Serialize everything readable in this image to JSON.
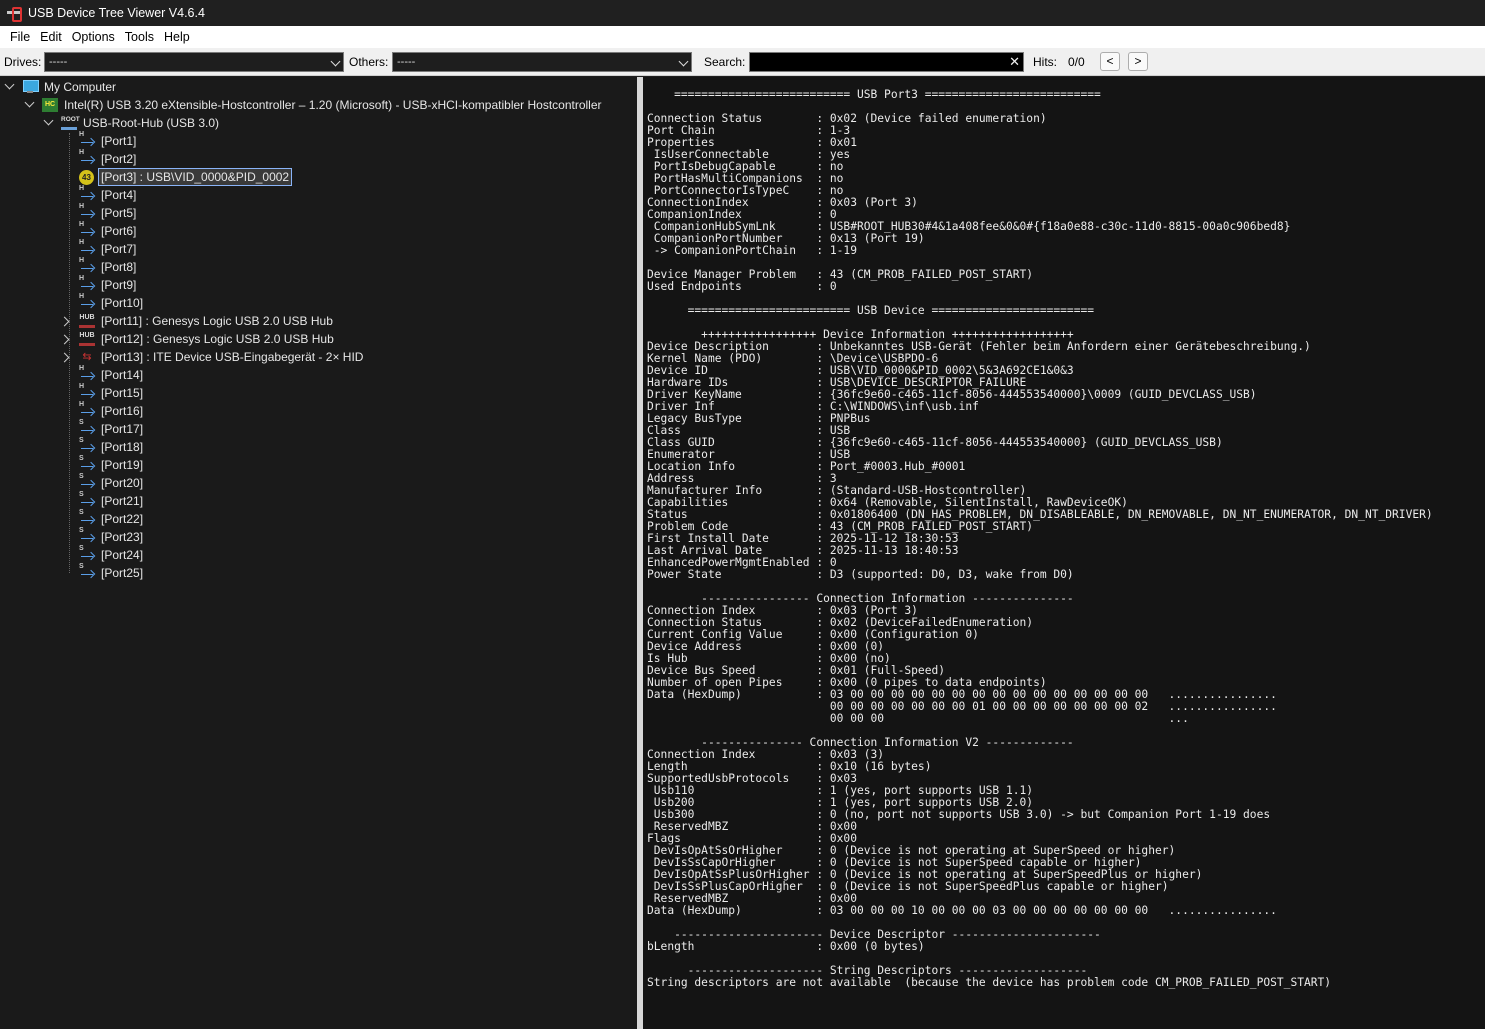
{
  "window": {
    "title": "USB Device Tree Viewer V4.6.4"
  },
  "menu": [
    "File",
    "Edit",
    "Options",
    "Tools",
    "Help"
  ],
  "toolbar": {
    "drives_label": "Drives:",
    "drives_value": "-----",
    "others_label": "Others:",
    "others_value": "-----",
    "search_label": "Search:",
    "search_value": "",
    "clear_glyph": "✕",
    "hits_label": "Hits:",
    "hits_value": "0/0",
    "prev": "<",
    "next": ">"
  },
  "tree": {
    "root": "My Computer",
    "controller": "Intel(R) USB 3.20 eXtensible-Hostcontroller – 1.20 (Microsoft) - USB-xHCI-kompatibler Hostcontroller",
    "hub": "USB-Root-Hub (USB 3.0)",
    "ports": [
      "[Port1]",
      "[Port2]",
      "[Port3] : USB\\VID_0000&PID_0002",
      "[Port4]",
      "[Port5]",
      "[Port6]",
      "[Port7]",
      "[Port8]",
      "[Port9]",
      "[Port10]",
      "[Port11] : Genesys Logic USB 2.0 USB Hub",
      "[Port12] : Genesys Logic USB 2.0 USB Hub",
      "[Port13] : ITE Device USB-Eingabegerät - 2× HID",
      "[Port14]",
      "[Port15]",
      "[Port16]",
      "[Port17]",
      "[Port18]",
      "[Port19]",
      "[Port20]",
      "[Port21]",
      "[Port22]",
      "[Port23]",
      "[Port24]",
      "[Port25]"
    ],
    "error_badge": "43",
    "hub_icon_text": "HUB",
    "root_icon_text": "ROOT",
    "hc_icon_text": "HC"
  },
  "details_text": "    ========================== USB Port3 ==========================\n\nConnection Status        : 0x02 (Device failed enumeration)\nPort Chain               : 1-3\nProperties               : 0x01\n IsUserConnectable       : yes\n PortIsDebugCapable      : no\n PortHasMultiCompanions  : no\n PortConnectorIsTypeC    : no\nConnectionIndex          : 0x03 (Port 3)\nCompanionIndex           : 0\n CompanionHubSymLnk      : USB#ROOT_HUB30#4&1a408fee&0&0#{f18a0e88-c30c-11d0-8815-00a0c906bed8}\n CompanionPortNumber     : 0x13 (Port 19)\n -> CompanionPortChain   : 1-19\n\nDevice Manager Problem   : 43 (CM_PROB_FAILED_POST_START)\nUsed Endpoints           : 0\n\n      ======================== USB Device ========================\n\n        +++++++++++++++++ Device Information ++++++++++++++++++\nDevice Description       : Unbekanntes USB-Gerät (Fehler beim Anfordern einer Gerätebeschreibung.)\nKernel Name (PDO)        : \\Device\\USBPDO-6\nDevice ID                : USB\\VID_0000&PID_0002\\5&3A692CE1&0&3\nHardware IDs             : USB\\DEVICE_DESCRIPTOR_FAILURE\nDriver KeyName           : {36fc9e60-c465-11cf-8056-444553540000}\\0009 (GUID_DEVCLASS_USB)\nDriver Inf               : C:\\WINDOWS\\inf\\usb.inf\nLegacy BusType           : PNPBus\nClass                    : USB\nClass GUID               : {36fc9e60-c465-11cf-8056-444553540000} (GUID_DEVCLASS_USB)\nEnumerator               : USB\nLocation Info            : Port_#0003.Hub_#0001\nAddress                  : 3\nManufacturer Info        : (Standard-USB-Hostcontroller)\nCapabilities             : 0x64 (Removable, SilentInstall, RawDeviceOK)\nStatus                   : 0x01806400 (DN_HAS_PROBLEM, DN_DISABLEABLE, DN_REMOVABLE, DN_NT_ENUMERATOR, DN_NT_DRIVER)\nProblem Code             : 43 (CM_PROB_FAILED_POST_START)\nFirst Install Date       : 2025-11-12 18:30:53\nLast Arrival Date        : 2025-11-13 18:40:53\nEnhancedPowerMgmtEnabled : 0\nPower State              : D3 (supported: D0, D3, wake from D0)\n\n        ---------------- Connection Information ---------------\nConnection Index         : 0x03 (Port 3)\nConnection Status        : 0x02 (DeviceFailedEnumeration)\nCurrent Config Value     : 0x00 (Configuration 0)\nDevice Address           : 0x00 (0)\nIs Hub                   : 0x00 (no)\nDevice Bus Speed         : 0x01 (Full-Speed)\nNumber of open Pipes     : 0x00 (0 pipes to data endpoints)\nData (HexDump)           : 03 00 00 00 00 00 00 00 00 00 00 00 00 00 00 00   ................\n                           00 00 00 00 00 00 00 01 00 00 00 00 00 00 00 02   ................\n                           00 00 00                                          ...\n\n        --------------- Connection Information V2 -------------\nConnection Index         : 0x03 (3)\nLength                   : 0x10 (16 bytes)\nSupportedUsbProtocols    : 0x03\n Usb110                  : 1 (yes, port supports USB 1.1)\n Usb200                  : 1 (yes, port supports USB 2.0)\n Usb300                  : 0 (no, port not supports USB 3.0) -> but Companion Port 1-19 does\n ReservedMBZ             : 0x00\nFlags                    : 0x00\n DevIsOpAtSsOrHigher     : 0 (Device is not operating at SuperSpeed or higher)\n DevIsSsCapOrHigher      : 0 (Device is not SuperSpeed capable or higher)\n DevIsOpAtSsPlusOrHigher : 0 (Device is not operating at SuperSpeedPlus or higher)\n DevIsSsPlusCapOrHigher  : 0 (Device is not SuperSpeedPlus capable or higher)\n ReservedMBZ             : 0x00\nData (HexDump)           : 03 00 00 00 10 00 00 00 03 00 00 00 00 00 00 00   ................\n\n    ---------------------- Device Descriptor ----------------------\nbLength                  : 0x00 (0 bytes)\n\n      -------------------- String Descriptors -------------------\nString descriptors are not available  (because the device has problem code CM_PROB_FAILED_POST_START)"
}
